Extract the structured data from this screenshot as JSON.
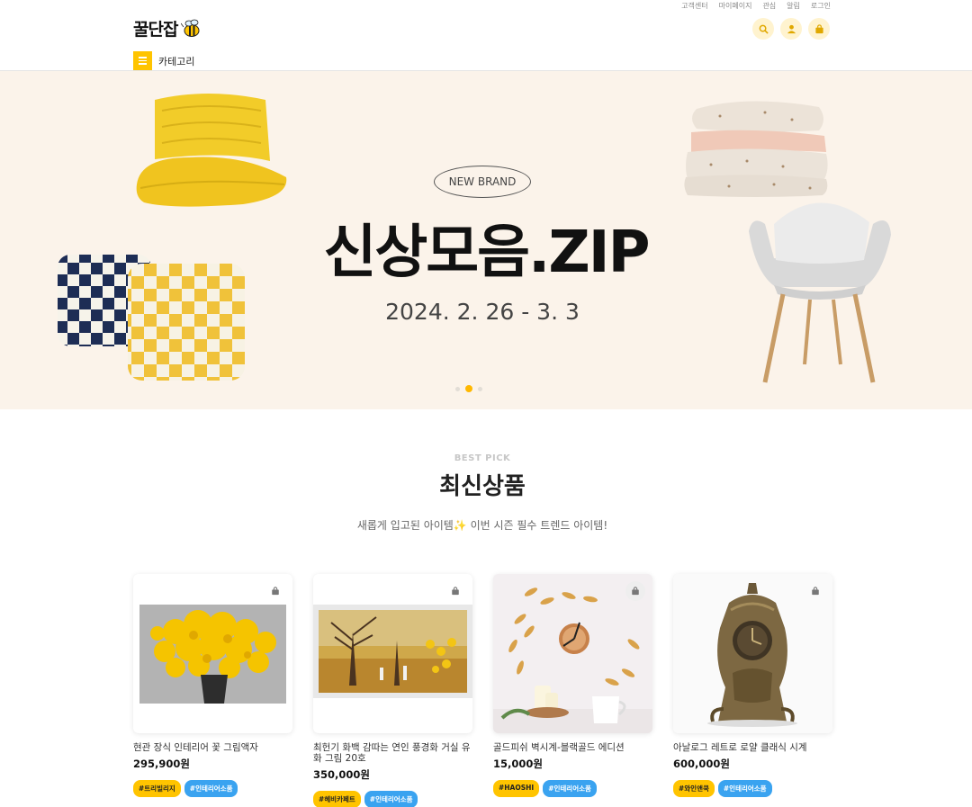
{
  "header": {
    "logo_text": "꿀단잡",
    "top_links": [
      "고객센터",
      "마이페이지",
      "관심",
      "알림",
      "로그인"
    ],
    "category_label": "카테고리",
    "icons": [
      "search-icon",
      "user-icon",
      "shopping-bag-icon"
    ],
    "accent_color": "#ffc400"
  },
  "banner": {
    "badge": "NEW BRAND",
    "title": "신상모음.ZIP",
    "date": "2024. 2. 26 - 3. 3",
    "background": "#fbf3ea",
    "active_slide": 2,
    "slide_count": 3
  },
  "section": {
    "sub": "BEST PICK",
    "title": "최신상품",
    "desc": "새롭게 입고된 아이템✨ 이번 시즌 필수 트렌드 아이템!"
  },
  "products": [
    {
      "name": "현관 장식 인테리어 꽃 그림액자",
      "price": "295,900원",
      "tags": [
        "#트리빌리지",
        "#인테리어소품"
      ]
    },
    {
      "name": "최헌기 화백 감따는 연인 풍경화 거실 유화 그림 20호",
      "price": "350,000원",
      "tags": [
        "#헤비카페트",
        "#인테리어소품"
      ]
    },
    {
      "name": "골드피쉬 벽시계-블랙골드 에디션",
      "price": "15,000원",
      "tags": [
        "#HAOSHI",
        "#인테리어소품"
      ]
    },
    {
      "name": "아날로그 레트로 로얄 클래식 시계",
      "price": "600,000원",
      "tags": [
        "#와인앤쿡",
        "#인테리어소품"
      ]
    }
  ]
}
